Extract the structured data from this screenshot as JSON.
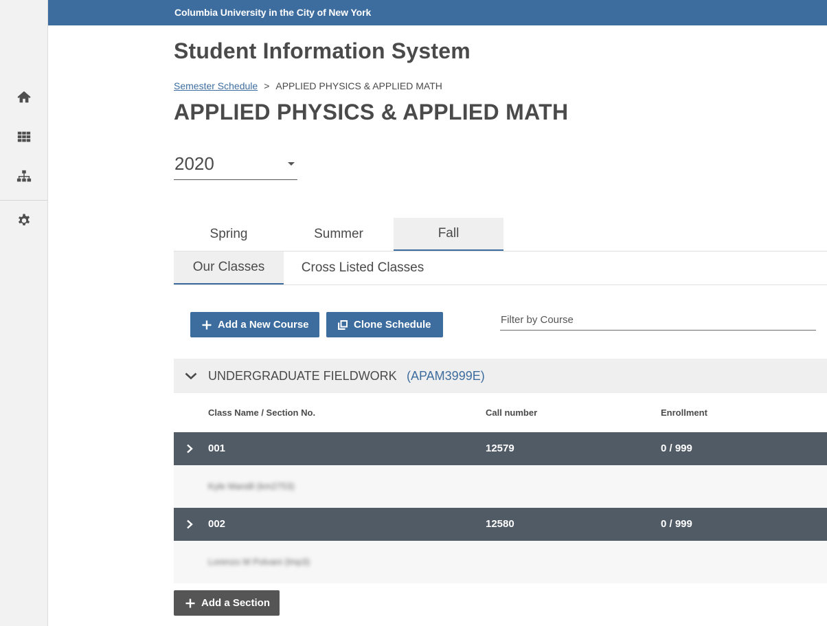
{
  "banner": {
    "text": "Columbia University in the City of New York"
  },
  "app": {
    "title": "Student Information System"
  },
  "sidebar": {
    "items": [
      {
        "name": "home",
        "icon": "home-icon"
      },
      {
        "name": "grid",
        "icon": "grid-icon"
      },
      {
        "name": "hierarchy",
        "icon": "sitemap-icon"
      },
      {
        "name": "settings",
        "icon": "gear-icon"
      }
    ]
  },
  "breadcrumb": {
    "link": "Semester Schedule",
    "separator": ">",
    "current": "APPLIED PHYSICS & APPLIED MATH"
  },
  "page": {
    "title": "APPLIED PHYSICS & APPLIED MATH"
  },
  "year_select": {
    "value": "2020"
  },
  "semester_tabs": [
    {
      "label": "Spring",
      "active": false
    },
    {
      "label": "Summer",
      "active": false
    },
    {
      "label": "Fall",
      "active": true
    }
  ],
  "class_tabs": [
    {
      "label": "Our Classes",
      "active": true
    },
    {
      "label": "Cross Listed Classes",
      "active": false
    }
  ],
  "toolbar": {
    "add_course_label": "Add a New Course",
    "clone_label": "Clone Schedule",
    "filter_placeholder": "Filter by Course"
  },
  "course": {
    "name": "UNDERGRADUATE FIELDWORK",
    "code": "(APAM3999E)"
  },
  "table": {
    "columns": [
      "Class Name / Section No.",
      "Call number",
      "Enrollment"
    ],
    "sections": [
      {
        "section": "001",
        "call_number": "12579",
        "enrollment": "0 / 999",
        "instructor": "Kyle Mandil (km2753)"
      },
      {
        "section": "002",
        "call_number": "12580",
        "enrollment": "0 / 999",
        "instructor": "Lorenzo M Polvani (lmp3)"
      }
    ]
  },
  "footer": {
    "add_section_label": "Add a Section"
  },
  "colors": {
    "primary": "#3d6d9f",
    "section_row": "#515b66",
    "text": "#4a4a4a"
  }
}
